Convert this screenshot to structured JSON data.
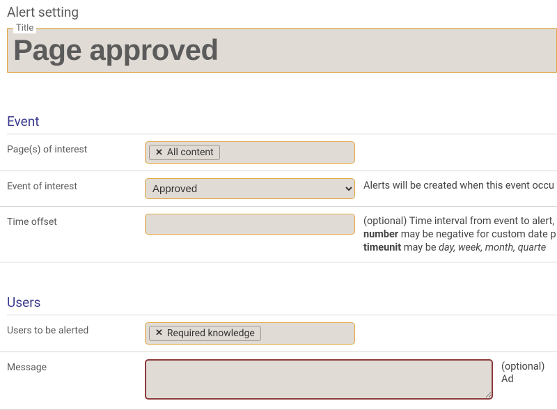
{
  "page": {
    "title": "Alert setting"
  },
  "title_field": {
    "legend": "Title",
    "value": "Page approved"
  },
  "sections": {
    "event": "Event",
    "users": "Users"
  },
  "rows": {
    "pages": {
      "label": "Page(s) of interest",
      "chip": "All content"
    },
    "event": {
      "label": "Event of interest",
      "value": "Approved",
      "help": "Alerts will be created when this event occu"
    },
    "offset": {
      "label": "Time offset",
      "value": "",
      "help_pre": "(optional) Time interval from event to alert,",
      "help_b1": "number",
      "help_mid1": " may be negative for custom date p",
      "help_b2": "timeunit",
      "help_mid2": " may be ",
      "help_i": "day, week, month, quarte"
    },
    "users": {
      "label": "Users to be alerted",
      "chip": "Required knowledge"
    },
    "message": {
      "label": "Message",
      "value": "",
      "help": "(optional) Ad"
    }
  }
}
